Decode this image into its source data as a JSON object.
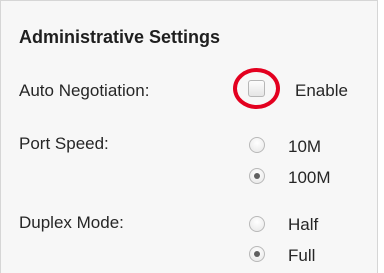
{
  "section": {
    "title": "Administrative Settings"
  },
  "auto_negotiation": {
    "label": "Auto Negotiation:",
    "checkbox_label": "Enable",
    "checked": false
  },
  "port_speed": {
    "label": "Port Speed:",
    "options": [
      {
        "label": "10M",
        "selected": false
      },
      {
        "label": "100M",
        "selected": true
      }
    ]
  },
  "duplex_mode": {
    "label": "Duplex Mode:",
    "options": [
      {
        "label": "Half",
        "selected": false
      },
      {
        "label": "Full",
        "selected": true
      }
    ]
  },
  "colors": {
    "highlight_ring": "#e3001f",
    "panel_background": "#f7f7f7",
    "text": "#262626"
  }
}
